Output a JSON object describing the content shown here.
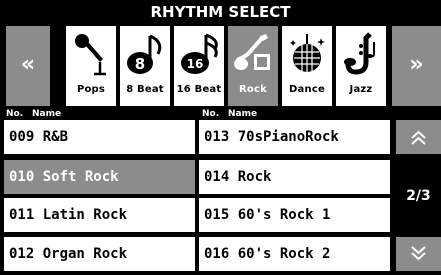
{
  "title": "RHYTHM SELECT",
  "nav": {
    "prev_label": "<<",
    "next_label": ">>"
  },
  "categories": [
    {
      "label": "Pops",
      "icon": "microphone-icon"
    },
    {
      "label": "8 Beat",
      "icon": "note-8-icon"
    },
    {
      "label": "16 Beat",
      "icon": "note-16-icon"
    },
    {
      "label": "Rock",
      "icon": "guitar-amp-icon",
      "selected": true
    },
    {
      "label": "Dance",
      "icon": "disco-ball-icon"
    },
    {
      "label": "Jazz",
      "icon": "saxophone-icon"
    }
  ],
  "list_header": {
    "no": "No.",
    "name": "Name"
  },
  "rhythms": [
    {
      "label": "009 R&B"
    },
    {
      "label": "010 Soft Rock",
      "selected": true
    },
    {
      "label": "011 Latin Rock"
    },
    {
      "label": "012 Organ Rock"
    },
    {
      "label": "013 70sPianoRock"
    },
    {
      "label": "014 Rock"
    },
    {
      "label": "015 60's Rock 1"
    },
    {
      "label": "016 60's Rock 2"
    }
  ],
  "pager": {
    "page": "2/3",
    "up_label": "^",
    "down_label": "v"
  },
  "colors": {
    "background": "#000000",
    "tile": "#ffffff",
    "selected": "#8c8c8c",
    "text_selected": "#ffffff"
  }
}
